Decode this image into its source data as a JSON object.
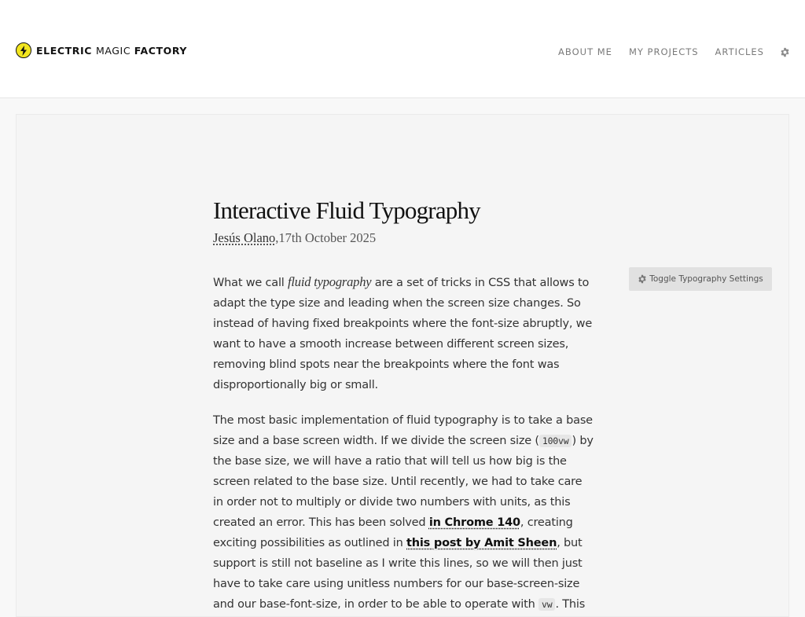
{
  "header": {
    "logo": {
      "part1": "ELECTRIC ",
      "part2": "MAGIC ",
      "part3": "FACTORY",
      "icon": "lightning-bolt-icon"
    },
    "nav": {
      "about": "ABOUT ME",
      "projects": "MY PROJECTS",
      "articles": "ARTICLES",
      "settings_icon": "gear-icon"
    }
  },
  "article": {
    "title": "Interactive Fluid Typography",
    "author": "Jesús Olano",
    "date": ",17th October 2025",
    "p1": {
      "before": "What we call ",
      "em": "fluid typography",
      "after": " are a set of tricks in CSS that allows to adapt the type size and leading when the screen size changes. So instead of having fixed breakpoints where the font-size abruptly, we want to have a smooth increase between different screen sizes, removing blind spots near the breakpoints where the font was disproportionally big or small."
    },
    "p2": {
      "t1": "The most basic implementation of fluid typography is to take a base size and a base screen width. If we divide the screen size (",
      "code1": "100vw",
      "t2": ") by the base size, we will have a ratio that will tell us how big is the screen related to the base size. Until recently, we had to take care in order not to multiply or divide two numbers with units, as this created an error. This has been solved ",
      "link1": "in Chrome 140",
      "t3": ", creating exciting possibilities as outlined in ",
      "link2": "this post by Amit Sheen",
      "t4": ", but support is still not baseline as I write this lines, so we will then just have to take care using unitless numbers for our base-screen-size and our base-font-size, in order to be able to operate with ",
      "code2": "vw",
      "t5": ". This"
    }
  },
  "toggle_button": {
    "label": "Toggle Typography Settings",
    "icon": "gear-icon"
  },
  "colors": {
    "logo_accent": "#f2e51f",
    "page_bg": "#f8f8f8",
    "header_bg": "#ffffff"
  }
}
